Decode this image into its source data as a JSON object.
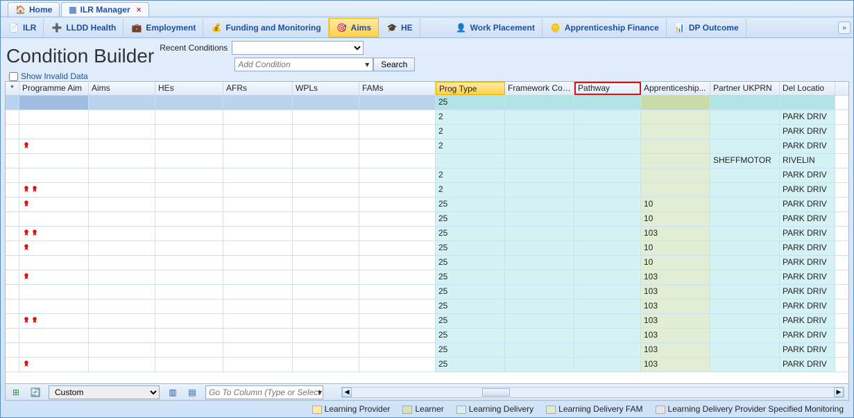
{
  "top_tabs": {
    "home": "Home",
    "ilr_mgr": "ILR Manager"
  },
  "ribbon": {
    "ilr": "ILR",
    "lldd": "LLDD Health",
    "employment": "Employment",
    "funding": "Funding and Monitoring",
    "aims": "Aims",
    "he": "HE",
    "work": "Work Placement",
    "apprfin": "Apprenticeship Finance",
    "dpout": "DP Outcome"
  },
  "cond": {
    "title": "Condition Builder",
    "recent_label": "Recent Conditions",
    "add_placeholder": "Add Condition",
    "search": "Search",
    "show_invalid": "Show Invalid Data"
  },
  "columns": {
    "star": "*",
    "prog_aim": "Programme Aim",
    "aims": "Aims",
    "hes": "HEs",
    "afrs": "AFRs",
    "wpls": "WPLs",
    "fams": "FAMs",
    "prog_type": "Prog Type",
    "fwk": "Framework Code",
    "pathway": "Pathway",
    "appr": "Apprenticeship...",
    "ukprn": "Partner UKPRN",
    "delloc": "Del Locatio"
  },
  "filter_row": {
    "prog_type": "25"
  },
  "rows": [
    {
      "rosette": 0,
      "prog_type": "2",
      "appr": "",
      "ukprn": "",
      "delloc": "PARK DRIV"
    },
    {
      "rosette": 0,
      "prog_type": "2",
      "appr": "",
      "ukprn": "",
      "delloc": "PARK DRIV"
    },
    {
      "rosette": 1,
      "prog_type": "2",
      "appr": "",
      "ukprn": "",
      "delloc": "PARK DRIV"
    },
    {
      "rosette": 0,
      "prog_type": "",
      "appr": "",
      "ukprn": "SHEFFMOTOR",
      "delloc": "RIVELIN"
    },
    {
      "rosette": 0,
      "prog_type": "2",
      "appr": "",
      "ukprn": "",
      "delloc": "PARK DRIV"
    },
    {
      "rosette": 2,
      "prog_type": "2",
      "appr": "",
      "ukprn": "",
      "delloc": "PARK DRIV"
    },
    {
      "rosette": 1,
      "prog_type": "25",
      "appr": "10",
      "ukprn": "",
      "delloc": "PARK DRIV"
    },
    {
      "rosette": 0,
      "prog_type": "25",
      "appr": "10",
      "ukprn": "",
      "delloc": "PARK DRIV"
    },
    {
      "rosette": 2,
      "prog_type": "25",
      "appr": "103",
      "ukprn": "",
      "delloc": "PARK DRIV"
    },
    {
      "rosette": 1,
      "prog_type": "25",
      "appr": "10",
      "ukprn": "",
      "delloc": "PARK DRIV"
    },
    {
      "rosette": 0,
      "prog_type": "25",
      "appr": "10",
      "ukprn": "",
      "delloc": "PARK DRIV"
    },
    {
      "rosette": 1,
      "prog_type": "25",
      "appr": "103",
      "ukprn": "",
      "delloc": "PARK DRIV"
    },
    {
      "rosette": 0,
      "prog_type": "25",
      "appr": "103",
      "ukprn": "",
      "delloc": "PARK DRIV"
    },
    {
      "rosette": 0,
      "prog_type": "25",
      "appr": "103",
      "ukprn": "",
      "delloc": "PARK DRIV"
    },
    {
      "rosette": 2,
      "prog_type": "25",
      "appr": "103",
      "ukprn": "",
      "delloc": "PARK DRIV"
    },
    {
      "rosette": 0,
      "prog_type": "25",
      "appr": "103",
      "ukprn": "",
      "delloc": "PARK DRIV"
    },
    {
      "rosette": 0,
      "prog_type": "25",
      "appr": "103",
      "ukprn": "",
      "delloc": "PARK DRIV"
    },
    {
      "rosette": 1,
      "prog_type": "25",
      "appr": "103",
      "ukprn": "",
      "delloc": "PARK DRIV"
    }
  ],
  "footer": {
    "view": "Custom",
    "goto_placeholder": "Go To Column (Type or Select)"
  },
  "legend": {
    "lp": "Learning Provider",
    "l": "Learner",
    "ld": "Learning Delivery",
    "fam": "Learning Delivery FAM",
    "psm": "Learning Delivery Provider Specified Monitoring"
  }
}
